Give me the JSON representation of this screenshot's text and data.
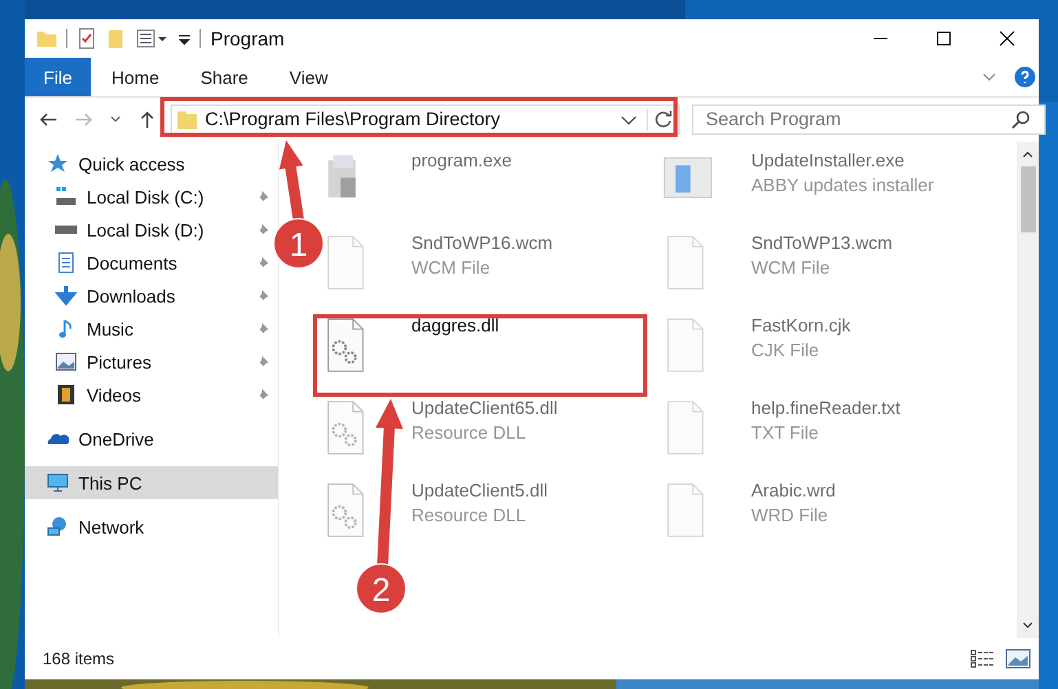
{
  "window": {
    "title": "Program"
  },
  "ribbon_tabs": [
    {
      "label": "File",
      "selected": true
    },
    {
      "label": "Home",
      "selected": false
    },
    {
      "label": "Share",
      "selected": false
    },
    {
      "label": "View",
      "selected": false
    }
  ],
  "address": {
    "value": "C:\\Program Files\\Program Directory"
  },
  "search": {
    "placeholder": "Search Program"
  },
  "sidebar": {
    "items": [
      {
        "label": "Quick access",
        "selected": false,
        "children": [
          {
            "label": "Local Disk (C:)",
            "selected": false,
            "pinned": true
          },
          {
            "label": "Local Disk (D:)",
            "selected": false,
            "pinned": true
          },
          {
            "label": "Documents",
            "selected": false,
            "pinned": true
          },
          {
            "label": "Downloads",
            "selected": false,
            "pinned": true
          },
          {
            "label": "Music",
            "selected": false,
            "pinned": true
          },
          {
            "label": "Pictures",
            "selected": false,
            "pinned": true
          },
          {
            "label": "Videos",
            "selected": false,
            "pinned": true
          }
        ]
      },
      {
        "label": "OneDrive",
        "selected": false
      },
      {
        "label": "This PC",
        "selected": true
      },
      {
        "label": "Network",
        "selected": false
      }
    ]
  },
  "files": [
    {
      "name": "program.exe",
      "kind": "exe",
      "dimmed": true
    },
    {
      "name": "UpdateInstaller.exe",
      "type": "ABBY updates installer",
      "kind": "installer",
      "dimmed": true
    },
    {
      "name": "SndToWP16.wcm",
      "type": "WCM File",
      "kind": "blank",
      "dimmed": true
    },
    {
      "name": "SndToWP13.wcm",
      "type": "WCM File",
      "kind": "blank",
      "dimmed": true
    },
    {
      "name": "daggres.dll",
      "kind": "dll",
      "dimmed": false
    },
    {
      "name": "FastKorn.cjk",
      "type": "CJK File",
      "kind": "blank",
      "dimmed": true
    },
    {
      "name": "UpdateClient65.dll",
      "type": "Resource DLL",
      "kind": "dll",
      "dimmed": true
    },
    {
      "name": "help.fineReader.txt",
      "type": "TXT File",
      "kind": "blank",
      "dimmed": true
    },
    {
      "name": "UpdateClient5.dll",
      "type": "Resource DLL",
      "kind": "dll",
      "dimmed": true
    },
    {
      "name": "Arabic.wrd",
      "type": "WRD File",
      "kind": "blank",
      "dimmed": true
    }
  ],
  "status_bar": {
    "count": "168 items"
  },
  "annotations": [
    {
      "number": "1"
    },
    {
      "number": "2"
    }
  ]
}
